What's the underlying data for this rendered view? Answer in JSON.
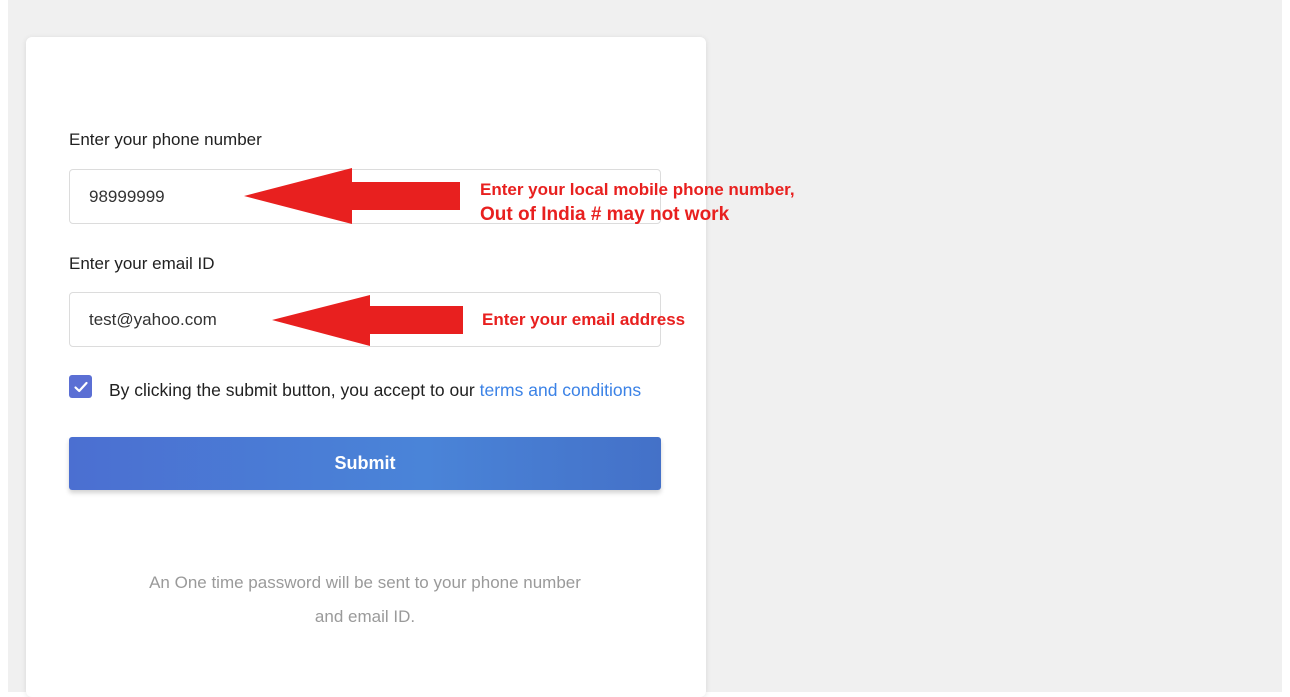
{
  "form": {
    "phone_label": "Enter your phone number",
    "phone_value": "98999999",
    "email_label": "Enter your email ID",
    "email_value": "test@yahoo.com",
    "terms_text": "By clicking the submit button, you accept to our ",
    "terms_link": "terms and conditions",
    "terms_checked": true,
    "submit_label": "Submit",
    "otp_note_line1": "An One time password will be sent to your phone number",
    "otp_note_line2": "and email ID."
  },
  "annotations": {
    "phone_note_line1": "Enter your local mobile phone number,",
    "phone_note_line2": "Out of India # may not work",
    "email_note": "Enter your email address",
    "arrow_color": "#e8201f"
  },
  "colors": {
    "accent": "#4a7bd6",
    "checkbox": "#5b6fd4",
    "link": "#3b82e6",
    "annotation": "#e8201f",
    "background": "#f0f0f0"
  }
}
